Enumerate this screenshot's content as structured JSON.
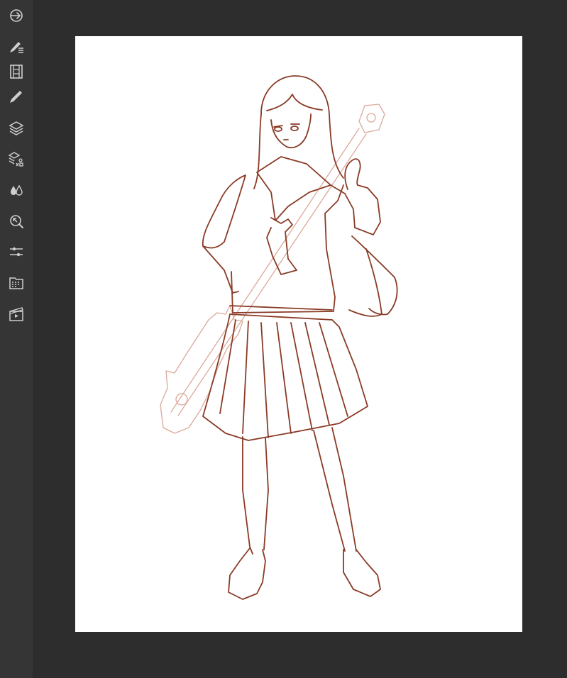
{
  "app": {
    "colors": {
      "workspace": "#2d2d2d",
      "sidebar": "#353535",
      "icon": "#cfcfcf",
      "paper": "#ffffff",
      "ink": "#8a3b26",
      "sketch": "#d9a99a"
    }
  },
  "toolbar": {
    "tools": [
      {
        "id": "exit",
        "icon": "exit-arrow-icon"
      },
      {
        "id": "brush-settings",
        "icon": "brush-settings-icon"
      },
      {
        "id": "frames",
        "icon": "film-strip-icon"
      },
      {
        "id": "brush",
        "icon": "brush-icon"
      },
      {
        "id": "layers",
        "icon": "layers-icon"
      },
      {
        "id": "layer-properties",
        "icon": "layer-shapes-icon"
      },
      {
        "id": "color",
        "icon": "color-drops-icon"
      },
      {
        "id": "navigator",
        "icon": "navigator-icon"
      },
      {
        "id": "adjustments",
        "icon": "sliders-icon"
      },
      {
        "id": "materials",
        "icon": "materials-folder-icon"
      },
      {
        "id": "animation",
        "icon": "animation-clapper-icon"
      }
    ]
  },
  "canvas": {
    "artwork": "line-art-schoolgirl-with-spiked-club"
  }
}
